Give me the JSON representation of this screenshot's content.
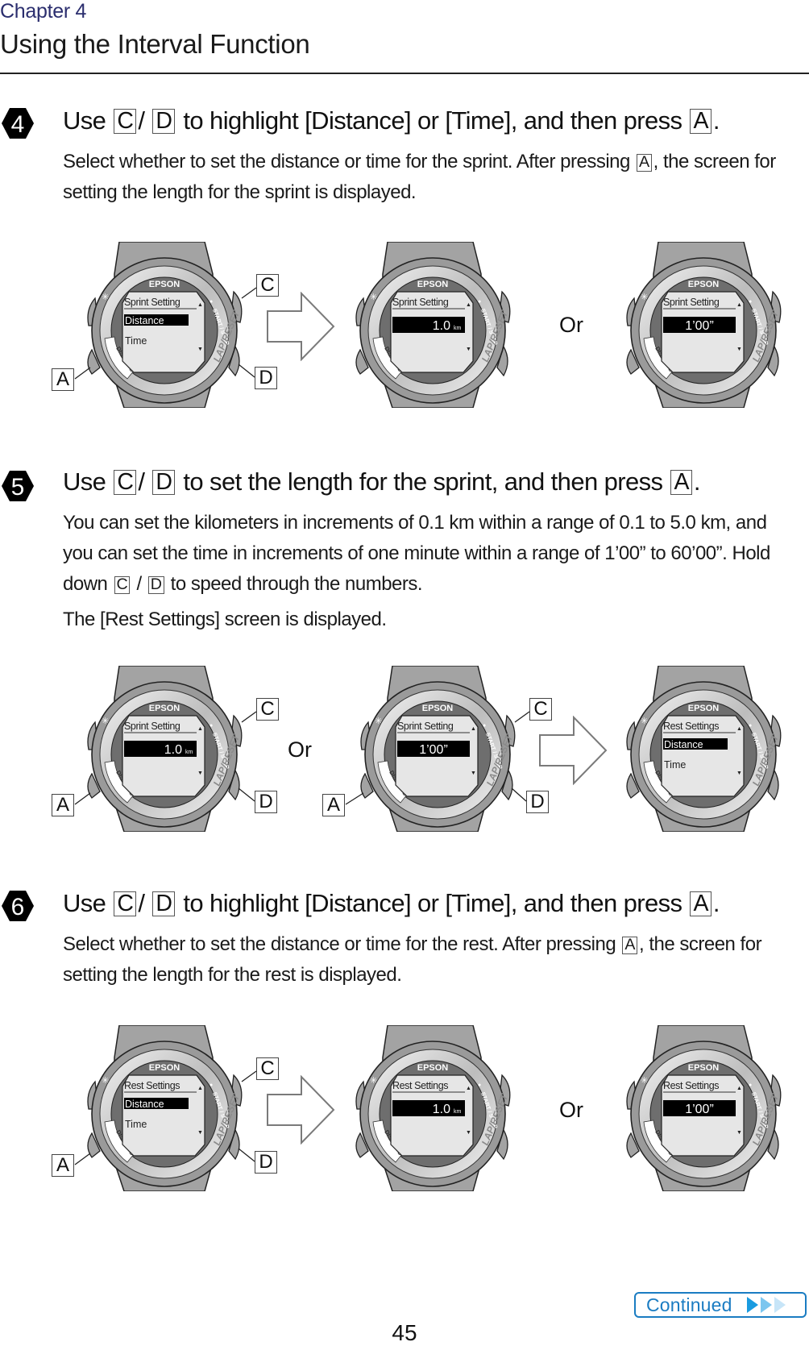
{
  "header": {
    "chapter": "Chapter 4",
    "title": "Using the Interval Function"
  },
  "keys": {
    "a": "A",
    "c": "C",
    "d": "D"
  },
  "steps": [
    {
      "number": "4",
      "heading": {
        "pre": "Use",
        "sep": "/",
        "mid": "to highlight [Distance] or [Time], and then press",
        "end": "."
      },
      "body": [
        {
          "pre": "Select whether to set the distance or time for the sprint. After pressing",
          "post": ", the screen for setting the length for the sprint is displayed."
        }
      ],
      "or_label": "Or"
    },
    {
      "number": "5",
      "heading": {
        "pre": "Use",
        "sep": "/",
        "mid": "to set the length for the sprint, and then press",
        "end": "."
      },
      "body_p1": "You can set the kilometers in increments of 0.1 km within a range of 0.1 to 5.0 km, and you can set the time in increments of one minute within a range of 1’00” to 60’00”. Hold down",
      "body_p1_sep": "/",
      "body_p1_post": "to speed through the numbers.",
      "body_p2": "The [Rest Settings] screen is displayed.",
      "or_label": "Or"
    },
    {
      "number": "6",
      "heading": {
        "pre": "Use",
        "sep": "/",
        "mid": "to highlight [Distance] or [Time], and then press",
        "end": "."
      },
      "body": [
        {
          "pre": "Select whether to set the distance or time for the rest. After pressing",
          "post": ", the screen for setting the length for the rest is displayed."
        }
      ],
      "or_label": "Or"
    }
  ],
  "watch": {
    "brand": "EPSON",
    "bezel_top_right": "START / STOP",
    "bezel_bottom_right": "LAP/RESET",
    "bezel_left": "DISP.CHG",
    "light_icon": "backlight-icon"
  },
  "watches": [
    {
      "id": "s4-w1",
      "title": "Sprint Setting",
      "mode": "menu",
      "item1": "Distance",
      "item2": "Time"
    },
    {
      "id": "s4-w2",
      "title": "Sprint Setting",
      "mode": "value",
      "value": "1.0",
      "unit": "km"
    },
    {
      "id": "s4-w3",
      "title": "Sprint Setting",
      "mode": "value",
      "value": "1’00”",
      "unit": ""
    },
    {
      "id": "s5-w1",
      "title": "Sprint Setting",
      "mode": "value",
      "value": "1.0",
      "unit": "km"
    },
    {
      "id": "s5-w2",
      "title": "Sprint Setting",
      "mode": "value",
      "value": "1’00”",
      "unit": ""
    },
    {
      "id": "s5-w3",
      "title": "Rest Settings",
      "mode": "menu",
      "item1": "Distance",
      "item2": "Time"
    },
    {
      "id": "s6-w1",
      "title": "Rest Settings",
      "mode": "menu",
      "item1": "Distance",
      "item2": "Time"
    },
    {
      "id": "s6-w2",
      "title": "Rest Settings",
      "mode": "value",
      "value": "1.0",
      "unit": "km"
    },
    {
      "id": "s6-w3",
      "title": "Rest Settings",
      "mode": "value",
      "value": "1’00”",
      "unit": ""
    }
  ],
  "footer": {
    "page_number": "45",
    "continued_label": "Continued",
    "accent": "#1a7cc2"
  }
}
